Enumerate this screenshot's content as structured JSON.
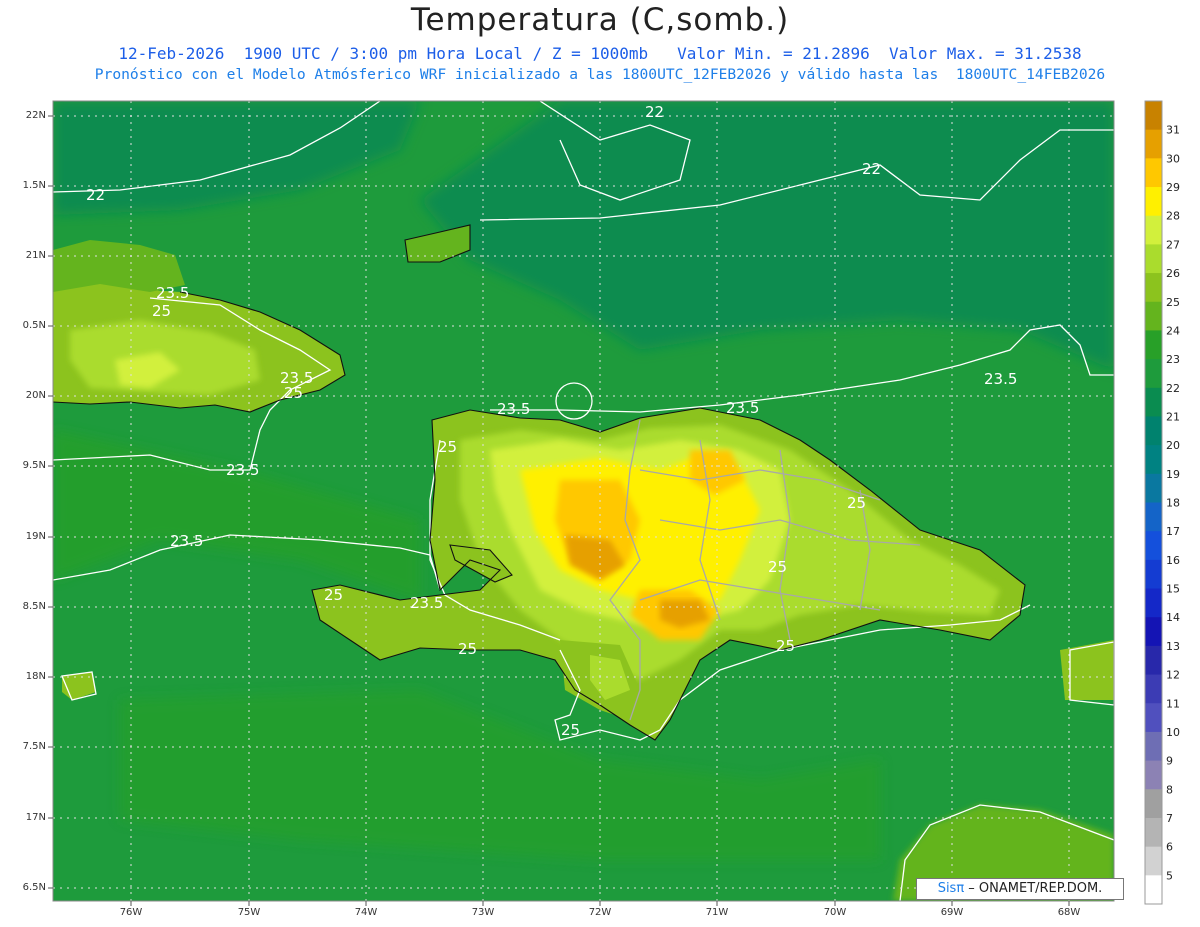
{
  "header": {
    "title": "Temperatura (C,somb.)",
    "line1": "12-Feb-2026  1900 UTC / 3:00 pm Hora Local / Z = 1000mb   Valor Min. = 21.2896  Valor Max. = 31.2538",
    "line2": "Pronóstico con el Modelo Atmósferico WRF inicializado a las 1800UTC_12FEB2026 y válido hasta las  1800UTC_14FEB2026"
  },
  "credit": {
    "brand": "Sisπ",
    "rest": " – ONAMET/REP.DOM."
  },
  "axes": {
    "lat_labels": [
      "22N",
      "1.5N",
      "21N",
      "0.5N",
      "20N",
      "9.5N",
      "19N",
      "8.5N",
      "18N",
      "7.5N",
      "17N",
      "6.5N"
    ],
    "lon_labels": [
      "76W",
      "75W",
      "74W",
      "73W",
      "72W",
      "71W",
      "70W",
      "69W",
      "68W"
    ]
  },
  "contours": [
    {
      "label": "22"
    },
    {
      "label": "22"
    },
    {
      "label": "22"
    },
    {
      "label": "23.5"
    },
    {
      "label": "23.5"
    },
    {
      "label": "23.5"
    },
    {
      "label": "23.5"
    },
    {
      "label": "23.5"
    },
    {
      "label": "23.5"
    },
    {
      "label": "23.5"
    },
    {
      "label": "23.5"
    },
    {
      "label": "25"
    },
    {
      "label": "25"
    },
    {
      "label": "25"
    },
    {
      "label": "25"
    },
    {
      "label": "25"
    },
    {
      "label": "25"
    },
    {
      "label": "25"
    },
    {
      "label": "25"
    },
    {
      "label": "25"
    }
  ],
  "colorbar": {
    "labels": [
      "31",
      "30",
      "29",
      "28",
      "27",
      "26",
      "25",
      "24",
      "23",
      "22",
      "21",
      "20",
      "19",
      "18",
      "17",
      "16",
      "15",
      "14",
      "13",
      "12",
      "11",
      "10",
      "9",
      "8",
      "7",
      "6",
      "5"
    ],
    "colors": [
      "#c88200",
      "#e6a000",
      "#ffc800",
      "#fff000",
      "#d2f03c",
      "#aadc2d",
      "#8cc31e",
      "#64b41e",
      "#28a028",
      "#1e9b3c",
      "#0a8c50",
      "#00826e",
      "#008282",
      "#0a78a0",
      "#1464c8",
      "#1450dc",
      "#143cd2",
      "#1428c8",
      "#1414b4",
      "#2828aa",
      "#3c3cb4",
      "#5050be",
      "#6e6eb4",
      "#8c82b4",
      "#a0a0a0",
      "#b4b4b4",
      "#d2d2d2",
      "#ffffff"
    ]
  }
}
